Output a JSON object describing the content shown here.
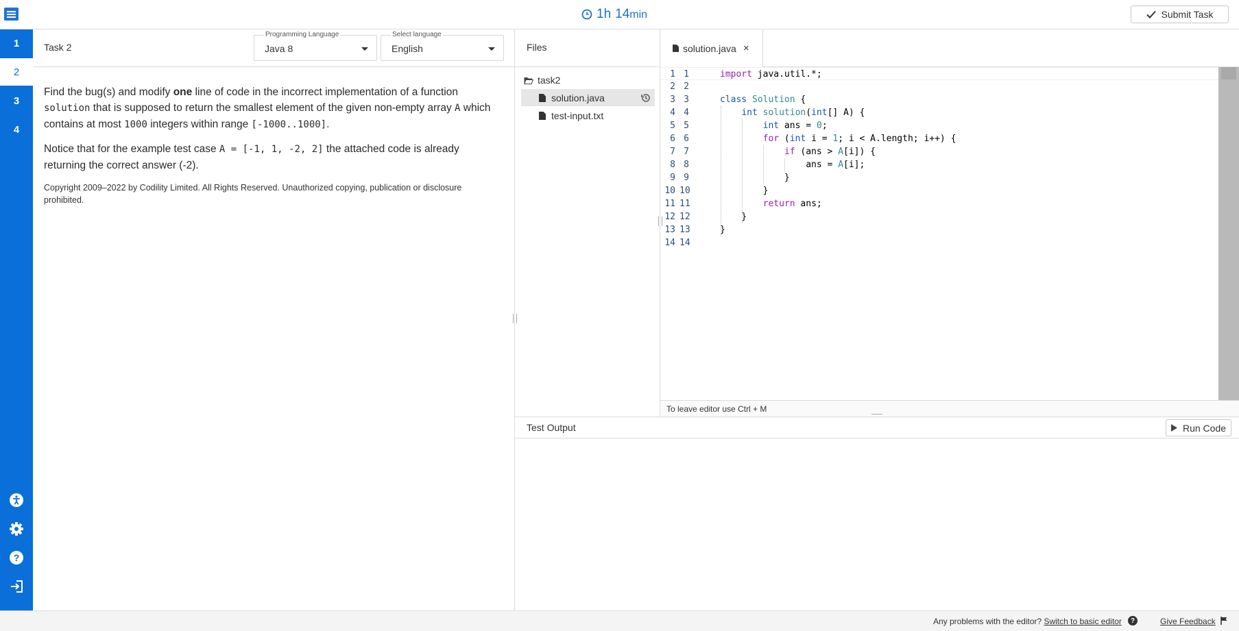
{
  "app": {
    "timer_hours": "1h",
    "timer_minutes": "14",
    "timer_unit": "min",
    "submit_label": "Submit Task",
    "accent_color": "#0a6fd8"
  },
  "nav": {
    "tasks": [
      "1",
      "2",
      "3",
      "4"
    ],
    "active_task": "2",
    "icons": [
      "accessibility-icon",
      "gear-icon",
      "help-icon",
      "logout-icon"
    ]
  },
  "task": {
    "title": "Task 2",
    "programming_language_label": "Programming Language",
    "programming_language_value": "Java 8",
    "select_language_label": "Select language",
    "select_language_value": "English",
    "p1_a": "Find the bug(s) and modify ",
    "p1_b": "one",
    "p1_c": " line of code in the incorrect implementation of a function ",
    "p1_d": "solution",
    "p1_e": " that is supposed to return the smallest element of the given non-empty array ",
    "p1_f": "A",
    "p1_g": " which contains at most ",
    "p1_h": "1000",
    "p1_i": " integers within range ",
    "p1_j": "[-1000..1000]",
    "p1_k": ".",
    "p2_a": "Notice that for the example test case ",
    "p2_b": "A = [-1, 1, -2, 2]",
    "p2_c": " the attached code is already returning the correct answer (-2).",
    "copyright": "Copyright 2009–2022 by Codility Limited. All Rights Reserved. Unauthorized copying, publication or disclosure prohibited."
  },
  "files": {
    "header": "Files",
    "folder": "task2",
    "items": [
      "solution.java",
      "test-input.txt"
    ],
    "selected": "solution.java"
  },
  "editor": {
    "tab_label": "solution.java",
    "close_glyph": "×",
    "footer_hint": "To leave editor use Ctrl + M"
  },
  "test_output": {
    "title": "Test Output",
    "run_label": "Run Code"
  },
  "footer": {
    "problems_text": "Any problems with the editor?",
    "switch_link": "Switch to basic editor",
    "feedback_link": "Give Feedback"
  }
}
